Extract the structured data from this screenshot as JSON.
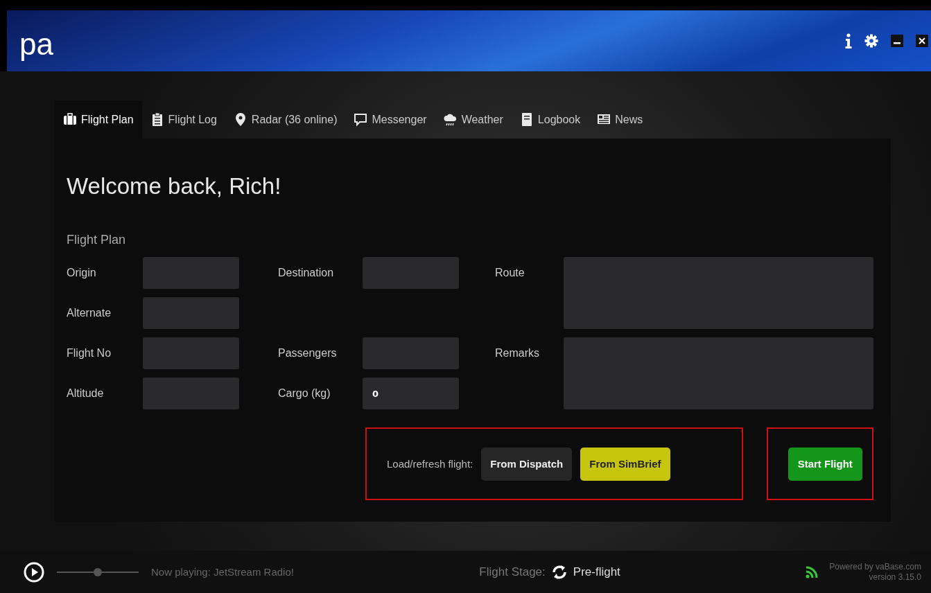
{
  "header": {
    "logo": "pa"
  },
  "tabs": [
    {
      "label": "Flight Plan",
      "selected": true
    },
    {
      "label": "Flight Log",
      "selected": false
    },
    {
      "label": "Radar (36 online)",
      "selected": false
    },
    {
      "label": "Messenger",
      "selected": false
    },
    {
      "label": "Weather",
      "selected": false
    },
    {
      "label": "Logbook",
      "selected": false
    },
    {
      "label": "News",
      "selected": false
    }
  ],
  "welcome": "Welcome back, Rich!",
  "section_title": "Flight Plan",
  "fields": [
    {
      "label": "Origin",
      "kind": "input"
    },
    {
      "label": "Destination",
      "kind": "input"
    },
    {
      "label": "Route",
      "kind": "textarea"
    },
    {
      "label": "Alternate",
      "kind": "input"
    },
    {
      "label": "Flight No",
      "kind": "input"
    },
    {
      "label": "Passengers",
      "kind": "input"
    },
    {
      "label": "Remarks",
      "kind": "textarea"
    },
    {
      "label": "Altitude",
      "kind": "input"
    },
    {
      "label": "Cargo (kg)",
      "value": "0",
      "kind": "input"
    }
  ],
  "load_label": "Load/refresh flight:",
  "buttons": [
    {
      "label": "From Dispatch",
      "kind": "dark"
    },
    {
      "label": "From SimBrief",
      "kind": "yellow"
    }
  ],
  "start_button": "Start Flight",
  "footer": {
    "now_playing": "Now playing: JetStream Radio!",
    "stage_label": "Flight Stage:",
    "stage": "Pre-flight",
    "powered": "Powered by vaBase.com",
    "version": "version 3.15.0",
    "volume": {
      "level": 0.5
    }
  }
}
